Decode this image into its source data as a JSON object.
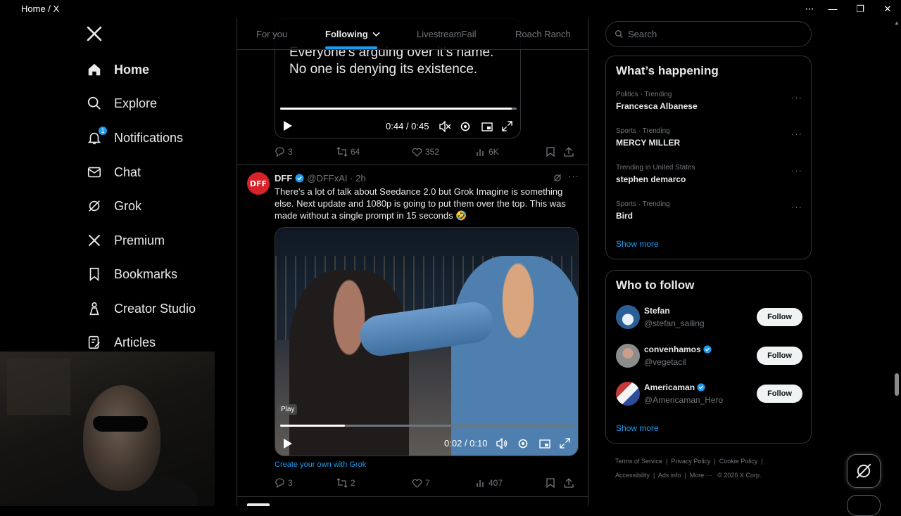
{
  "window": {
    "title": "Home / X",
    "controls": [
      "⋯",
      "—",
      "❐",
      "✕"
    ]
  },
  "sidebar": {
    "items": [
      {
        "label": "Home",
        "icon": "home-icon",
        "active": true
      },
      {
        "label": "Explore",
        "icon": "search-icon"
      },
      {
        "label": "Notifications",
        "icon": "bell-icon",
        "badge": "1"
      },
      {
        "label": "Chat",
        "icon": "mail-icon"
      },
      {
        "label": "Grok",
        "icon": "grok-icon"
      },
      {
        "label": "Premium",
        "icon": "x-logo-icon"
      },
      {
        "label": "Bookmarks",
        "icon": "bookmark-icon"
      },
      {
        "label": "Creator Studio",
        "icon": "creator-studio-icon"
      },
      {
        "label": "Articles",
        "icon": "articles-icon"
      }
    ]
  },
  "tabs": [
    {
      "label": "For you"
    },
    {
      "label": "Following",
      "active": true
    },
    {
      "label": "LivestreamFail"
    },
    {
      "label": "Roach Ranch"
    }
  ],
  "prev_tweet": {
    "video_text": [
      "Everyone's arguing over it's name.",
      "No one is denying its existence."
    ],
    "time": "0:44 / 0:45",
    "progress": 0.98,
    "replies": "3",
    "reposts": "64",
    "likes": "352",
    "views": "6K"
  },
  "tweet": {
    "avatar_text": "DFF",
    "name": "DFF",
    "handle_time": "@DFFxAI · 2h",
    "text": "There's a lot of talk about Seedance 2.0 but Grok Imagine is something else. Next update and 1080p is going to  put them over the top. This was made without a single prompt in 15 seconds 🤣",
    "play_tag": "Play",
    "time": "0:02 / 0:10",
    "progress": 0.22,
    "grok_link": "Create your own with Grok",
    "replies": "3",
    "reposts": "2",
    "likes": "7",
    "views": "407"
  },
  "search": {
    "placeholder": "Search"
  },
  "whats_happening": {
    "title": "What’s happening",
    "trends": [
      {
        "context": "Politics · Trending",
        "topic": "Francesca Albanese"
      },
      {
        "context": "Sports · Trending",
        "topic": "MERCY MILLER"
      },
      {
        "context": "Trending in United States",
        "topic": "stephen demarco"
      },
      {
        "context": "Sports · Trending",
        "topic": "Bird"
      }
    ],
    "show_more": "Show more"
  },
  "who_to_follow": {
    "title": "Who to follow",
    "accounts": [
      {
        "name": "Stefan",
        "handle": "@stefan_sailing",
        "verified": false,
        "button": "Follow"
      },
      {
        "name": "convenhamos",
        "handle": "@vegetacil",
        "verified": true,
        "button": "Follow"
      },
      {
        "name": "Americaman",
        "handle": "@Americaman_Hero",
        "verified": true,
        "button": "Follow"
      }
    ],
    "show_more": "Show more"
  },
  "footer": {
    "links": [
      "Terms of Service",
      "Privacy Policy",
      "Cookie Policy",
      "Accessibility",
      "Ads info",
      "More ···"
    ],
    "copyright": "© 2026 X Corp."
  },
  "colors": {
    "accent": "#1d9bf0",
    "background": "#000000",
    "border": "#2f3336",
    "muted": "#71767b"
  }
}
